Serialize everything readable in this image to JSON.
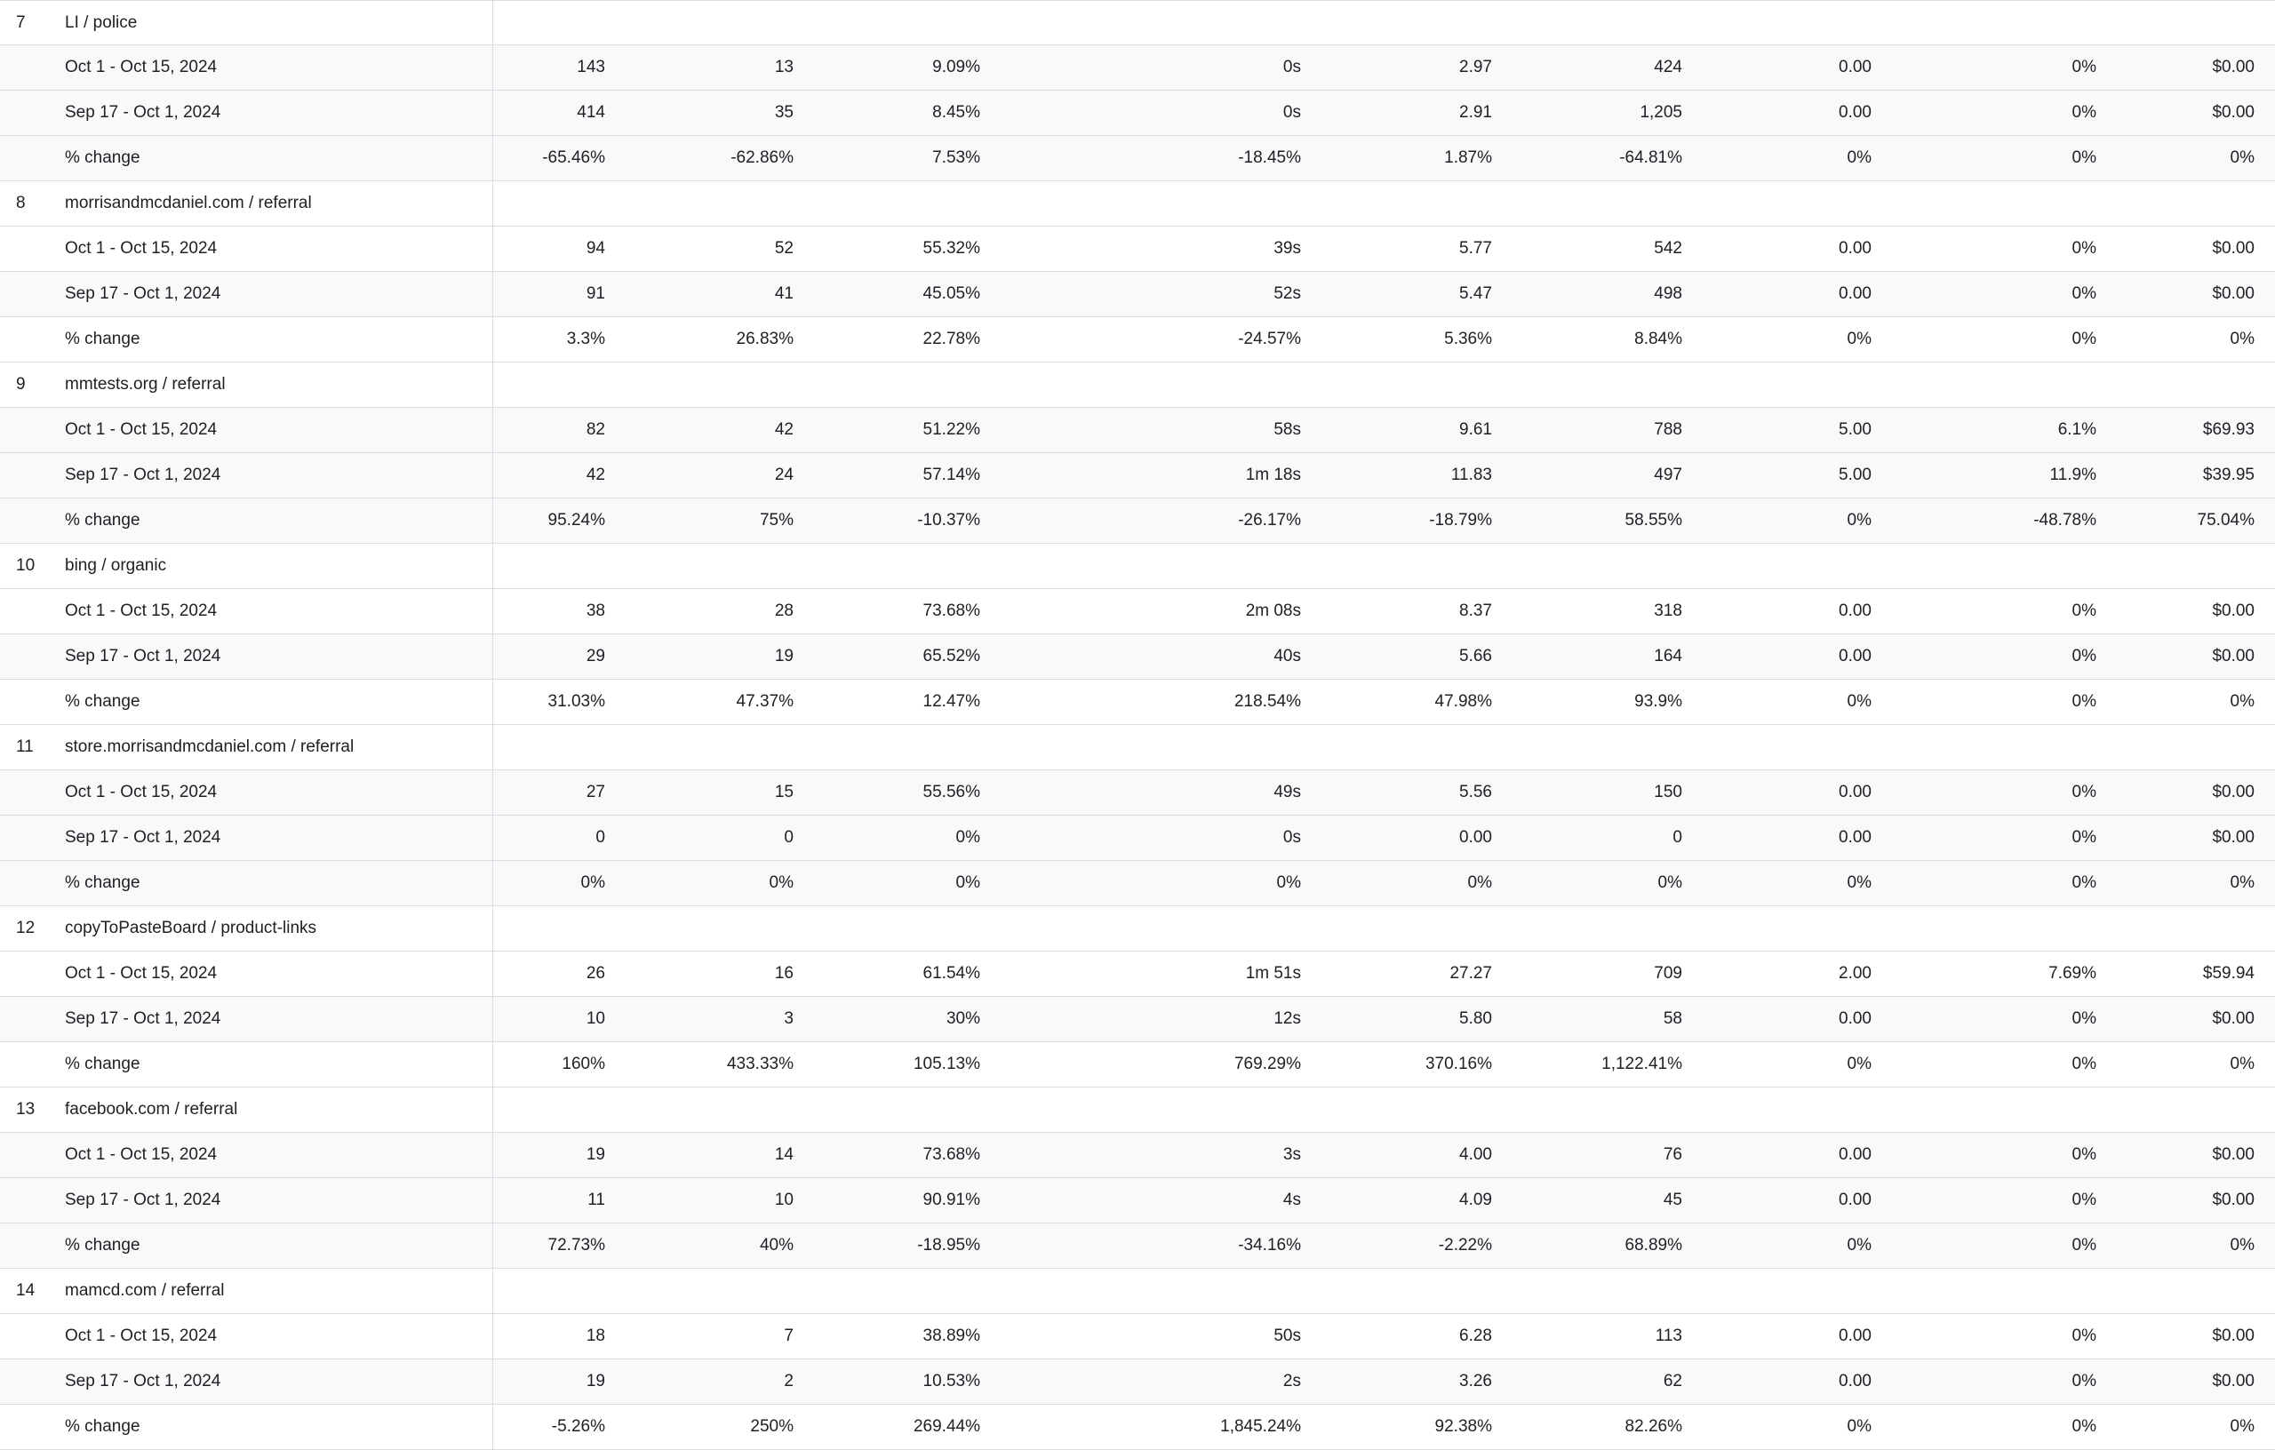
{
  "table": {
    "groups": [
      {
        "index": "7",
        "name": "LI / police",
        "rows": [
          {
            "label": "Oct 1 - Oct 15, 2024",
            "values": [
              "143",
              "13",
              "9.09%",
              "0s",
              "2.97",
              "424",
              "0.00",
              "0%",
              "$0.00"
            ]
          },
          {
            "label": "Sep 17 - Oct 1, 2024",
            "values": [
              "414",
              "35",
              "8.45%",
              "0s",
              "2.91",
              "1,205",
              "0.00",
              "0%",
              "$0.00"
            ]
          },
          {
            "label": "% change",
            "values": [
              "-65.46%",
              "-62.86%",
              "7.53%",
              "-18.45%",
              "1.87%",
              "-64.81%",
              "0%",
              "0%",
              "0%"
            ]
          }
        ]
      },
      {
        "index": "8",
        "name": "morrisandmcdaniel.com / referral",
        "rows": [
          {
            "label": "Oct 1 - Oct 15, 2024",
            "values": [
              "94",
              "52",
              "55.32%",
              "39s",
              "5.77",
              "542",
              "0.00",
              "0%",
              "$0.00"
            ]
          },
          {
            "label": "Sep 17 - Oct 1, 2024",
            "values": [
              "91",
              "41",
              "45.05%",
              "52s",
              "5.47",
              "498",
              "0.00",
              "0%",
              "$0.00"
            ]
          },
          {
            "label": "% change",
            "values": [
              "3.3%",
              "26.83%",
              "22.78%",
              "-24.57%",
              "5.36%",
              "8.84%",
              "0%",
              "0%",
              "0%"
            ]
          }
        ]
      },
      {
        "index": "9",
        "name": "mmtests.org / referral",
        "rows": [
          {
            "label": "Oct 1 - Oct 15, 2024",
            "values": [
              "82",
              "42",
              "51.22%",
              "58s",
              "9.61",
              "788",
              "5.00",
              "6.1%",
              "$69.93"
            ]
          },
          {
            "label": "Sep 17 - Oct 1, 2024",
            "values": [
              "42",
              "24",
              "57.14%",
              "1m 18s",
              "11.83",
              "497",
              "5.00",
              "11.9%",
              "$39.95"
            ]
          },
          {
            "label": "% change",
            "values": [
              "95.24%",
              "75%",
              "-10.37%",
              "-26.17%",
              "-18.79%",
              "58.55%",
              "0%",
              "-48.78%",
              "75.04%"
            ]
          }
        ]
      },
      {
        "index": "10",
        "name": "bing / organic",
        "rows": [
          {
            "label": "Oct 1 - Oct 15, 2024",
            "values": [
              "38",
              "28",
              "73.68%",
              "2m 08s",
              "8.37",
              "318",
              "0.00",
              "0%",
              "$0.00"
            ]
          },
          {
            "label": "Sep 17 - Oct 1, 2024",
            "values": [
              "29",
              "19",
              "65.52%",
              "40s",
              "5.66",
              "164",
              "0.00",
              "0%",
              "$0.00"
            ]
          },
          {
            "label": "% change",
            "values": [
              "31.03%",
              "47.37%",
              "12.47%",
              "218.54%",
              "47.98%",
              "93.9%",
              "0%",
              "0%",
              "0%"
            ]
          }
        ]
      },
      {
        "index": "11",
        "name": "store.morrisandmcdaniel.com / referral",
        "rows": [
          {
            "label": "Oct 1 - Oct 15, 2024",
            "values": [
              "27",
              "15",
              "55.56%",
              "49s",
              "5.56",
              "150",
              "0.00",
              "0%",
              "$0.00"
            ]
          },
          {
            "label": "Sep 17 - Oct 1, 2024",
            "values": [
              "0",
              "0",
              "0%",
              "0s",
              "0.00",
              "0",
              "0.00",
              "0%",
              "$0.00"
            ]
          },
          {
            "label": "% change",
            "values": [
              "0%",
              "0%",
              "0%",
              "0%",
              "0%",
              "0%",
              "0%",
              "0%",
              "0%"
            ]
          }
        ]
      },
      {
        "index": "12",
        "name": "copyToPasteBoard / product-links",
        "rows": [
          {
            "label": "Oct 1 - Oct 15, 2024",
            "values": [
              "26",
              "16",
              "61.54%",
              "1m 51s",
              "27.27",
              "709",
              "2.00",
              "7.69%",
              "$59.94"
            ]
          },
          {
            "label": "Sep 17 - Oct 1, 2024",
            "values": [
              "10",
              "3",
              "30%",
              "12s",
              "5.80",
              "58",
              "0.00",
              "0%",
              "$0.00"
            ]
          },
          {
            "label": "% change",
            "values": [
              "160%",
              "433.33%",
              "105.13%",
              "769.29%",
              "370.16%",
              "1,122.41%",
              "0%",
              "0%",
              "0%"
            ]
          }
        ]
      },
      {
        "index": "13",
        "name": "facebook.com / referral",
        "rows": [
          {
            "label": "Oct 1 - Oct 15, 2024",
            "values": [
              "19",
              "14",
              "73.68%",
              "3s",
              "4.00",
              "76",
              "0.00",
              "0%",
              "$0.00"
            ]
          },
          {
            "label": "Sep 17 - Oct 1, 2024",
            "values": [
              "11",
              "10",
              "90.91%",
              "4s",
              "4.09",
              "45",
              "0.00",
              "0%",
              "$0.00"
            ]
          },
          {
            "label": "% change",
            "values": [
              "72.73%",
              "40%",
              "-18.95%",
              "-34.16%",
              "-2.22%",
              "68.89%",
              "0%",
              "0%",
              "0%"
            ]
          }
        ]
      },
      {
        "index": "14",
        "name": "mamcd.com / referral",
        "rows": [
          {
            "label": "Oct 1 - Oct 15, 2024",
            "values": [
              "18",
              "7",
              "38.89%",
              "50s",
              "6.28",
              "113",
              "0.00",
              "0%",
              "$0.00"
            ]
          },
          {
            "label": "Sep 17 - Oct 1, 2024",
            "values": [
              "19",
              "2",
              "10.53%",
              "2s",
              "3.26",
              "62",
              "0.00",
              "0%",
              "$0.00"
            ]
          },
          {
            "label": "% change",
            "values": [
              "-5.26%",
              "250%",
              "269.44%",
              "1,845.24%",
              "92.38%",
              "82.26%",
              "0%",
              "0%",
              "0%"
            ]
          }
        ]
      }
    ]
  }
}
